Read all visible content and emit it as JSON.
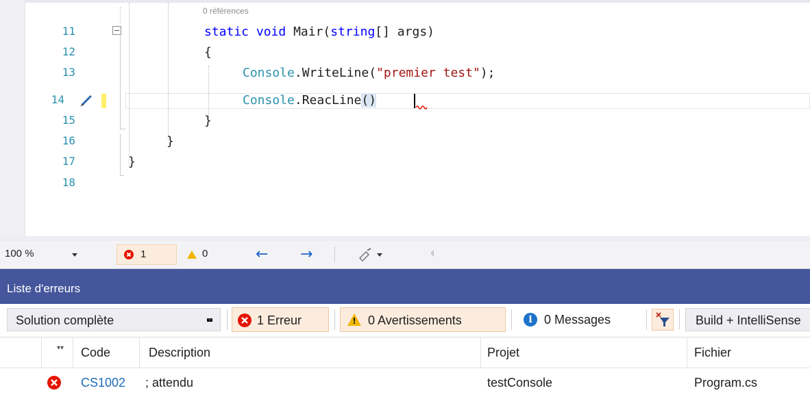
{
  "editor": {
    "reference_hint": "0 références",
    "line_numbers": [
      "11",
      "12",
      "13",
      "14",
      "15",
      "16",
      "17",
      "18"
    ],
    "code": {
      "line11": {
        "kw1": "static",
        "kw2": "void",
        "method": " Mair(",
        "kw3": "string",
        "rest": "[] args)"
      },
      "line12": "{",
      "line13": {
        "cls": "Console",
        "mid": ".WriteLine(",
        "str": "\"premier test\"",
        "end": ");"
      },
      "line14": {
        "cls": "Console",
        "mid": ".ReacLine",
        "paren": "()"
      },
      "line15": "}",
      "line16": "}",
      "line17": "}"
    }
  },
  "status_strip": {
    "zoom": "100 %",
    "error_count": "1",
    "warning_count": "0",
    "back_arrow": "←",
    "forward_arrow": "→"
  },
  "error_list": {
    "title": "Liste d'erreurs",
    "scope": "Solution complète",
    "errors_label": "1 Erreur",
    "warnings_label": "0 Avertissements",
    "messages_label": "0 Messages",
    "build_source": "Build + IntelliSense",
    "columns": {
      "code": "Code",
      "description": "Description",
      "project": "Projet",
      "file": "Fichier"
    },
    "rows": [
      {
        "code": "CS1002",
        "description": "; attendu",
        "project": "testConsole",
        "file": "Program.cs"
      }
    ]
  },
  "colors": {
    "error": "#e51400",
    "warning": "#f2b600",
    "info": "#1e72c8",
    "panel_title": "#46569c",
    "keyword": "#0000ff",
    "type": "#2b91af",
    "string": "#a31515"
  },
  "icons": [
    "error-icon",
    "warning-icon",
    "info-icon",
    "back-arrow-icon",
    "forward-arrow-icon",
    "brush-icon",
    "filter-icon",
    "collapse-icon"
  ]
}
